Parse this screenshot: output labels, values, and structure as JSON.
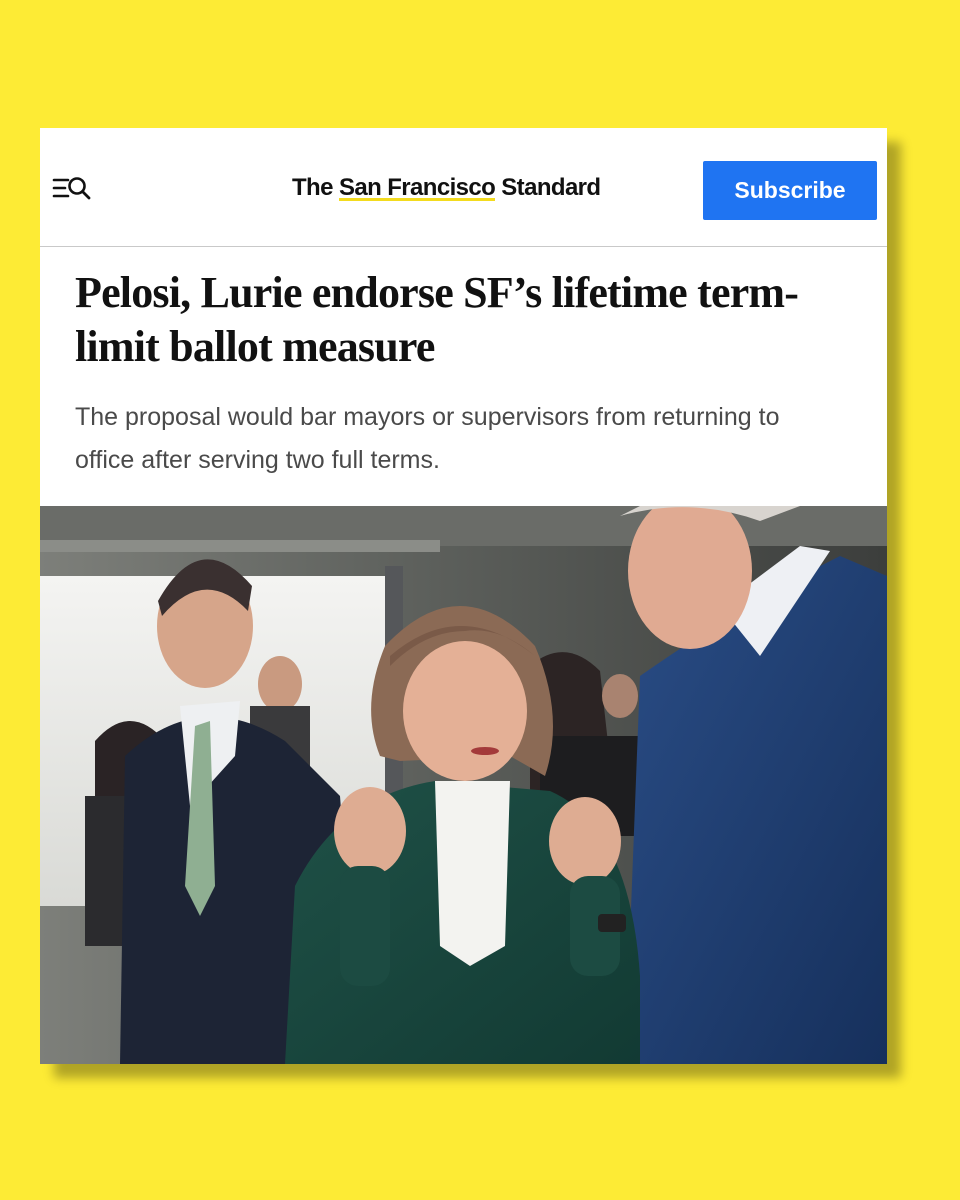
{
  "colors": {
    "background": "#FDEB35",
    "card": "#ffffff",
    "subscribe_button": "#1F74F2",
    "logo_highlight": "#F3DB1E",
    "headline_text": "#111111",
    "dek_text": "#4a4a4a"
  },
  "header": {
    "menu_icon": "menu-search-icon",
    "logo_prefix": "The ",
    "logo_highlight": "San Francisco",
    "logo_suffix": " Standard",
    "subscribe_label": "Subscribe"
  },
  "article": {
    "headline": "Pelosi, Lurie endorse SF’s lifetime term-limit ballot measure",
    "dek": "The proposal would bar mayors or supervisors from returning to office after serving two full terms."
  }
}
